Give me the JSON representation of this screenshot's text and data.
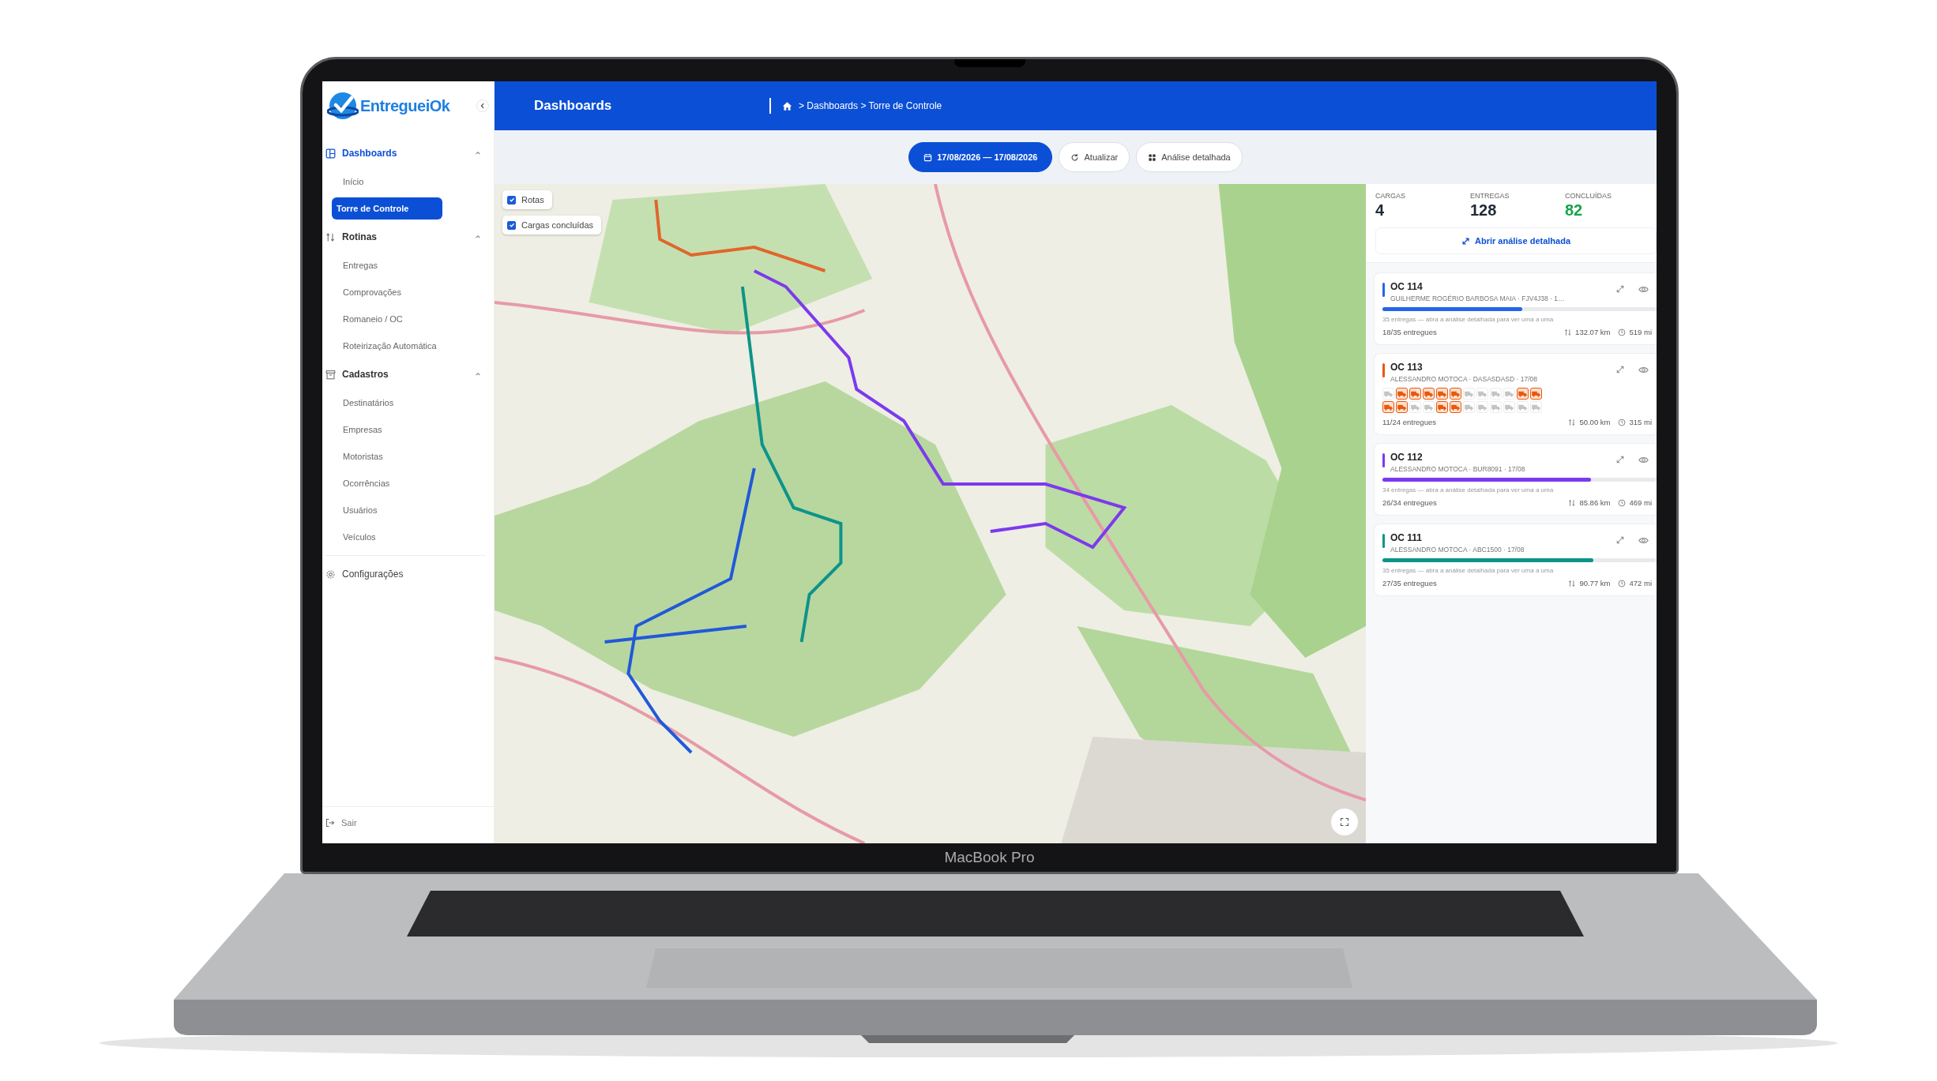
{
  "laptop": {
    "model_label": "MacBook Pro"
  },
  "sidebar": {
    "brand": "EntregueiOk",
    "sections": [
      {
        "title": "Dashboards",
        "kind": "dashboard",
        "expanded": true,
        "active": true,
        "items": [
          {
            "label": "Início",
            "selected": false
          },
          {
            "label": "Torre de Controle",
            "selected": true
          }
        ]
      },
      {
        "title": "Rotinas",
        "kind": "routines",
        "expanded": true,
        "active": false,
        "items": [
          {
            "label": "Entregas",
            "selected": false
          },
          {
            "label": "Comprovações",
            "selected": false
          },
          {
            "label": "Romaneio / OC",
            "selected": false
          },
          {
            "label": "Roteirização Automática",
            "selected": false
          }
        ]
      },
      {
        "title": "Cadastros",
        "kind": "registry",
        "expanded": true,
        "active": false,
        "items": [
          {
            "label": "Destinatários",
            "selected": false
          },
          {
            "label": "Empresas",
            "selected": false
          },
          {
            "label": "Motoristas",
            "selected": false
          },
          {
            "label": "Ocorrências",
            "selected": false
          },
          {
            "label": "Usuários",
            "selected": false
          },
          {
            "label": "Veículos",
            "selected": false
          }
        ]
      }
    ],
    "settings": "Configurações",
    "logout": "Sair"
  },
  "header": {
    "title": "Dashboards",
    "breadcrumb": "> Dashboards > Torre de Controle"
  },
  "toolbar": {
    "date_range": "17/08/2026 — 17/08/2026",
    "refresh": "Atualizar",
    "details": "Análise detalhada"
  },
  "map": {
    "kind": "picture",
    "layers": [
      {
        "label": "Rotas",
        "checked": true
      },
      {
        "label": "Cargas concluídas",
        "checked": true
      }
    ]
  },
  "summary": {
    "stats": [
      {
        "label": "CARGAS",
        "value": "4",
        "kind": "plain"
      },
      {
        "label": "ENTREGAS",
        "value": "128",
        "kind": "plain"
      },
      {
        "label": "CONCLUÍDAS",
        "value": "82",
        "kind": "success"
      }
    ],
    "open_link": "Abrir análise detalhada"
  },
  "loads": [
    {
      "title": "OC 114",
      "color": "#2563eb",
      "subtitle": "GUILHERME ROGÉRIO BARBOSA MAIA · FJV4J38 · 1…",
      "kind": "bar",
      "level": 0.51,
      "note": "35 entregas — abra a análise detalhada para ver uma a uma",
      "delivered": "18/35 entregues",
      "distance": "132.07 km",
      "duration": "519 mi"
    },
    {
      "title": "OC 113",
      "color": "#ea580c",
      "subtitle": "ALESSANDRO MOTOCA · DASASDASD · 17/08",
      "kind": "tiles",
      "stops": [
        {
          "delivered": false
        },
        {
          "delivered": true
        },
        {
          "delivered": true
        },
        {
          "delivered": true
        },
        {
          "delivered": true
        },
        {
          "delivered": true
        },
        {
          "delivered": false
        },
        {
          "delivered": false
        },
        {
          "delivered": false
        },
        {
          "delivered": false
        },
        {
          "delivered": true
        },
        {
          "delivered": true
        },
        {
          "delivered": true
        },
        {
          "delivered": true
        },
        {
          "delivered": false
        },
        {
          "delivered": false
        },
        {
          "delivered": true
        },
        {
          "delivered": true
        },
        {
          "delivered": false
        },
        {
          "delivered": false
        },
        {
          "delivered": false
        },
        {
          "delivered": false
        },
        {
          "delivered": false
        },
        {
          "delivered": false
        }
      ],
      "delivered": "11/24 entregues",
      "distance": "50.00 km",
      "duration": "315 mi"
    },
    {
      "title": "OC 112",
      "color": "#7c3aed",
      "subtitle": "ALESSANDRO MOTOCA · BUR8091 · 17/08",
      "kind": "bar",
      "level": 0.76,
      "note": "34 entregas — abra a análise detalhada para ver uma a uma",
      "delivered": "26/34 entregues",
      "distance": "85.86 km",
      "duration": "469 mi"
    },
    {
      "title": "OC 111",
      "color": "#0d9488",
      "subtitle": "ALESSANDRO MOTOCA · ABC1500 · 17/08",
      "kind": "bar",
      "level": 0.77,
      "note": "35 entregas — abra a análise detalhada para ver uma a uma",
      "delivered": "27/35 entregues",
      "distance": "90.77 km",
      "duration": "472 mi"
    }
  ]
}
